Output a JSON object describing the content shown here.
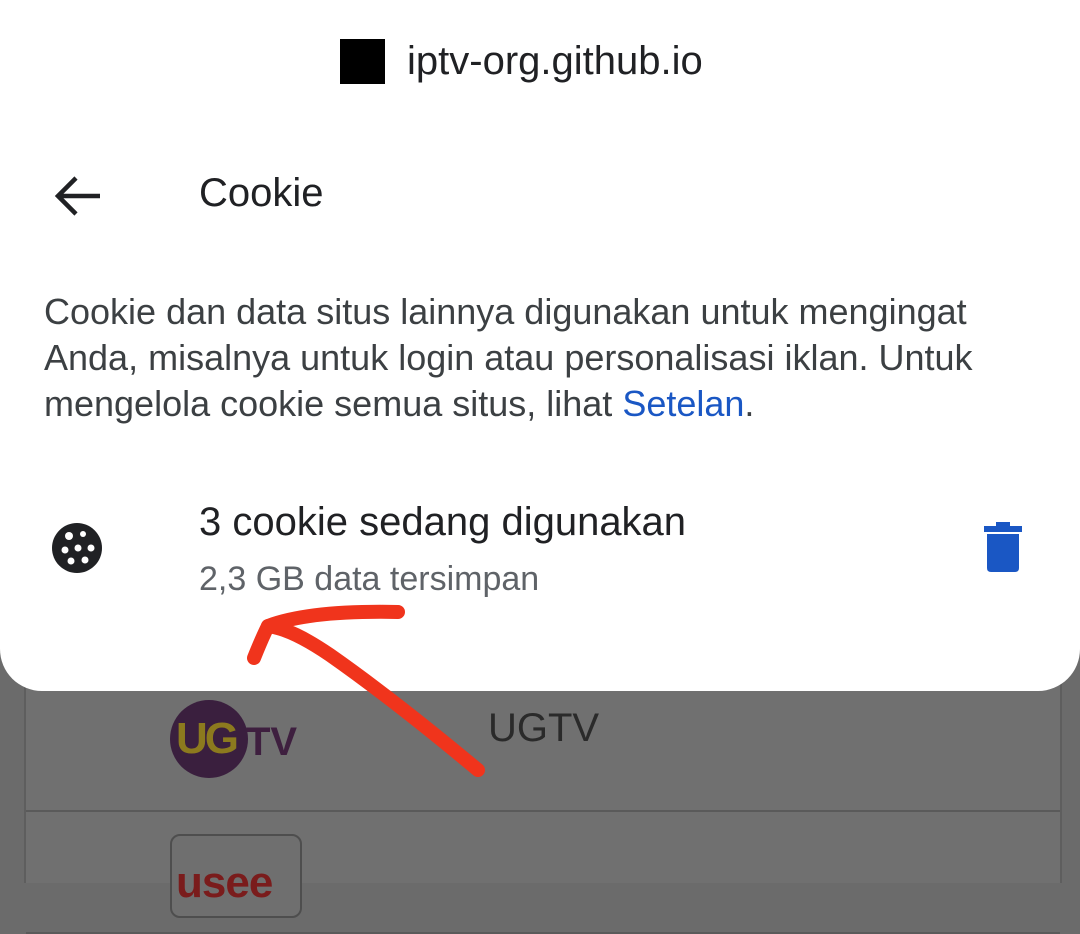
{
  "origin": {
    "host": "iptv-org.github.io",
    "favicon_icon": "black-square-favicon"
  },
  "header": {
    "back_icon": "arrow-left-icon",
    "title": "Cookie"
  },
  "description": {
    "text": "Cookie dan data situs lainnya digunakan untuk mengingat Anda, misalnya untuk login atau personalisasi iklan. Untuk mengelola cookie semua situs, lihat ",
    "link_label": "Setelan",
    "suffix": "."
  },
  "cookies": {
    "icon": "cookie-icon",
    "count_label": "3 cookie sedang digunakan",
    "storage_label": "2,3 GB data tersimpan",
    "delete_icon": "trash-icon",
    "delete_color": "#1a57c4"
  },
  "background_list": {
    "items": [
      {
        "logo_text": "UGTV",
        "title": "UGTV"
      },
      {
        "logo_text": "usee",
        "title": ""
      }
    ]
  },
  "annotation": {
    "color": "#f0341c",
    "shape": "hand-drawn-arrow"
  }
}
